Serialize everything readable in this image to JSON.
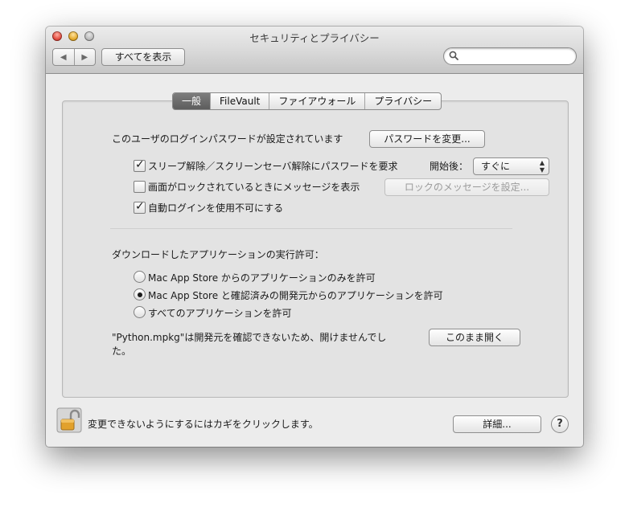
{
  "window": {
    "title": "セキュリティとプライバシー"
  },
  "toolbar": {
    "back_icon": "chevron-left-icon",
    "forward_icon": "chevron-right-icon",
    "show_all_label": "すべてを表示",
    "search_placeholder": "",
    "search_value": ""
  },
  "tabs": [
    {
      "label": "一般",
      "active": true
    },
    {
      "label": "FileVault",
      "active": false
    },
    {
      "label": "ファイアウォール",
      "active": false
    },
    {
      "label": "プライバシー",
      "active": false
    }
  ],
  "general": {
    "password_text": "このユーザのログインパスワードが設定されています",
    "change_password_label": "パスワードを変更...",
    "require_password": {
      "label": "スリープ解除／スクリーンセーバ解除にパスワードを要求",
      "checked": true
    },
    "after_label": "開始後：",
    "after_value": "すぐに",
    "show_message": {
      "label": "画面がロックされているときにメッセージを表示",
      "checked": false
    },
    "set_message_label": "ロックのメッセージを設定...",
    "disable_autologin": {
      "label": "自動ログインを使用不可にする",
      "checked": true
    },
    "download_heading": "ダウンロードしたアプリケーションの実行許可：",
    "radio_options": [
      {
        "label": "Mac App Store からのアプリケーションのみを許可",
        "selected": false
      },
      {
        "label": "Mac App Store と確認済みの開発元からのアプリケーションを許可",
        "selected": true
      },
      {
        "label": "すべてのアプリケーションを許可",
        "selected": false
      }
    ],
    "blocked_message_line1": "\"Python.mpkg\"は開発元を確認できないため、開けませんでし",
    "blocked_message_line2": "た。",
    "open_anyway_label": "このまま開く"
  },
  "footer": {
    "lock_text": "変更できないようにするにはカギをクリックします。",
    "lock_icon": "unlocked-padlock-icon",
    "advanced_label": "詳細...",
    "help_label": "?"
  }
}
